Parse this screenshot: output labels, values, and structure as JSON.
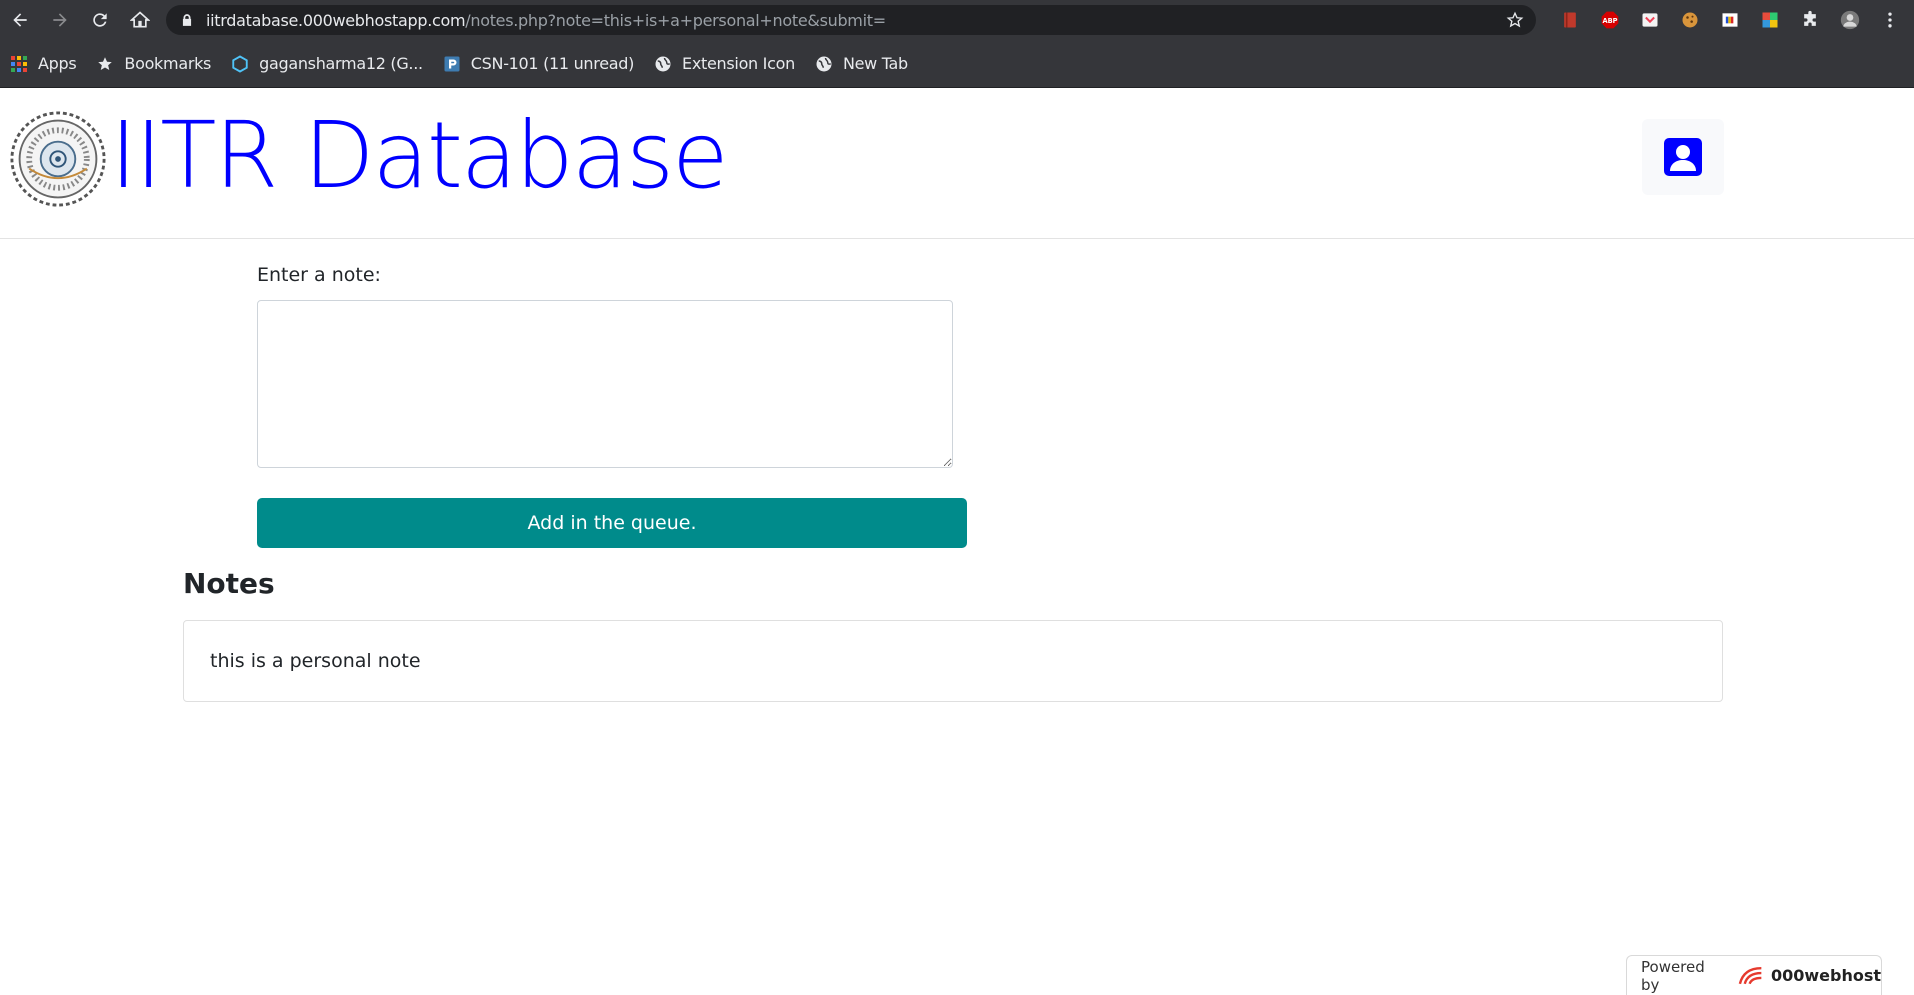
{
  "browser": {
    "url_host": "iitrdatabase.000webhostapp.com",
    "url_path": "/notes.php?note=this+is+a+personal+note&submit=",
    "extensions": [
      "book-extension-icon",
      "adblock-plus-icon",
      "pocket-icon",
      "cookie-icon",
      "flag-extension-icon",
      "palette-extension-icon",
      "puzzle-icon",
      "profile-avatar-icon",
      "menu-kebab-icon"
    ],
    "adblock_label": "ABP"
  },
  "bookmarks": [
    {
      "label": "Apps",
      "icon": "apps-grid-icon"
    },
    {
      "label": "Bookmarks",
      "icon": "star-icon"
    },
    {
      "label": "gagansharma12 (G...",
      "icon": "hexagon-icon"
    },
    {
      "label": "CSN-101 (11 unread)",
      "icon": "piazza-icon"
    },
    {
      "label": "Extension Icon",
      "icon": "globe-icon"
    },
    {
      "label": "New Tab",
      "icon": "globe-icon"
    }
  ],
  "header": {
    "title": "IITR Database",
    "brand_color": "#0000ff"
  },
  "form": {
    "label": "Enter a note:",
    "textarea_value": "",
    "submit_label": "Add in the queue.",
    "button_color": "#008b8b"
  },
  "notes": {
    "heading": "Notes",
    "items": [
      "this is a personal note"
    ]
  },
  "footer": {
    "powered_label": "Powered by",
    "brand": "000webhost"
  }
}
